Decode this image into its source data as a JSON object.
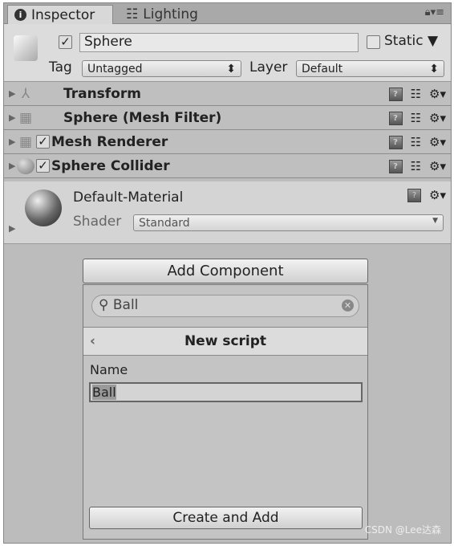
{
  "tabs": [
    {
      "label": "Inspector",
      "icon": "info-icon"
    },
    {
      "label": "Lighting",
      "icon": "sliders-icon"
    }
  ],
  "header": {
    "name": "Sphere",
    "active": true,
    "static_label": "Static",
    "static": false,
    "tag_label": "Tag",
    "tag_value": "Untagged",
    "layer_label": "Layer",
    "layer_value": "Default"
  },
  "components": [
    {
      "label": "Transform",
      "icon": "transform-icon",
      "checkbox": false
    },
    {
      "label": "Sphere (Mesh Filter)",
      "icon": "mesh-filter-icon",
      "checkbox": false
    },
    {
      "label": "Mesh Renderer",
      "icon": "mesh-renderer-icon",
      "checkbox": true
    },
    {
      "label": "Sphere Collider",
      "icon": "sphere-collider-icon",
      "checkbox": true
    }
  ],
  "material": {
    "name": "Default-Material",
    "shader_label": "Shader",
    "shader_value": "Standard"
  },
  "add_component": {
    "button": "Add Component",
    "search_value": "Ball",
    "panel_title": "New script",
    "name_label": "Name",
    "name_value": "Ball",
    "create_button": "Create and Add"
  },
  "watermark": "CSDN @Lee达森"
}
